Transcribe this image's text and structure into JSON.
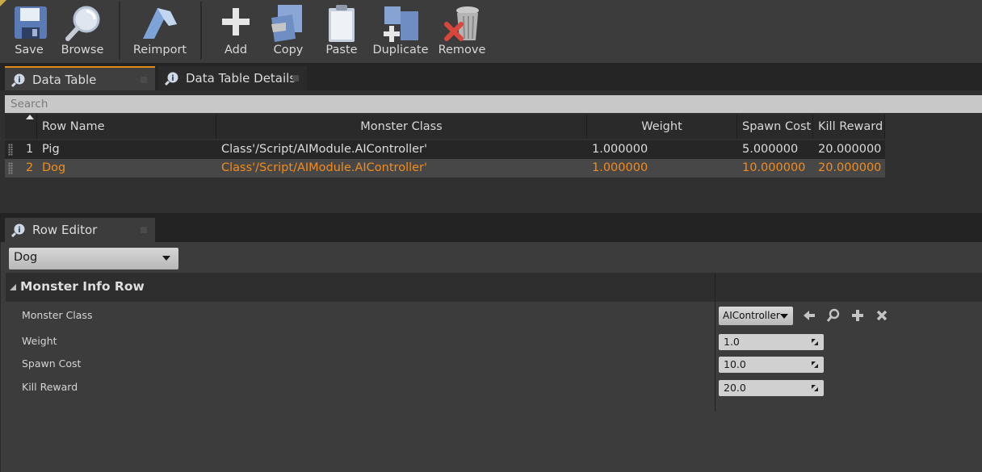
{
  "toolbar": {
    "save": "Save",
    "browse": "Browse",
    "reimport": "Reimport",
    "add": "Add",
    "copy": "Copy",
    "paste": "Paste",
    "duplicate": "Duplicate",
    "remove": "Remove"
  },
  "tabs": {
    "data_table": "Data Table",
    "data_table_details": "Data Table Details",
    "row_editor": "Row Editor"
  },
  "search": {
    "placeholder": "Search"
  },
  "table": {
    "columns": [
      "Row Name",
      "Monster Class",
      "Weight",
      "Spawn Cost",
      "Kill Reward"
    ],
    "rows": [
      {
        "index": "1",
        "name": "Pig",
        "monster_class": "Class'/Script/AIModule.AIController'",
        "weight": "1.000000",
        "spawn_cost": "5.000000",
        "kill_reward": "20.000000"
      },
      {
        "index": "2",
        "name": "Dog",
        "monster_class": "Class'/Script/AIModule.AIController'",
        "weight": "1.000000",
        "spawn_cost": "10.000000",
        "kill_reward": "20.000000"
      }
    ],
    "selected_row": 2
  },
  "row_editor": {
    "selected_row": "Dog",
    "category": "Monster Info Row",
    "properties": {
      "monster_class_label": "Monster Class",
      "monster_class_value": "AIController",
      "weight_label": "Weight",
      "weight_value": "1.0",
      "spawn_cost_label": "Spawn Cost",
      "spawn_cost_value": "10.0",
      "kill_reward_label": "Kill Reward",
      "kill_reward_value": "20.0"
    }
  },
  "colors": {
    "selected_text": "#f28c1e",
    "active_tab_accent": "#e08a1c",
    "background": "#3c3c3c"
  }
}
